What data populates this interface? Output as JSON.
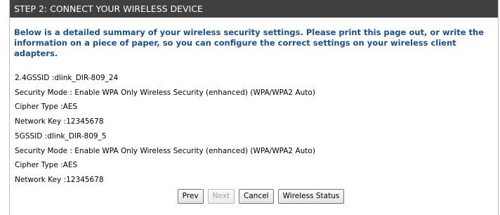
{
  "header": {
    "title": "STEP 2: CONNECT YOUR WIRELESS DEVICE"
  },
  "intro": "Below is a detailed summary of your wireless security settings. Please print this page out, or write the information on a piece of paper, so you can configure the correct settings on your wireless client adapters.",
  "band_24": {
    "ssid": "2.4GSSID :dlink_DIR-809_24",
    "security_mode": "Security Mode : Enable WPA Only Wireless Security (enhanced) (WPA/WPA2 Auto)",
    "cipher": "Cipher Type :AES",
    "network_key": "Network Key :12345678"
  },
  "band_5": {
    "ssid": "5GSSID :dlink_DIR-809_5",
    "security_mode": "Security Mode : Enable WPA Only Wireless Security (enhanced) (WPA/WPA2 Auto)",
    "cipher": "Cipher Type :AES",
    "network_key": "Network Key :12345678"
  },
  "buttons": {
    "prev": "Prev",
    "next": "Next",
    "cancel": "Cancel",
    "wireless_status": "Wireless Status"
  }
}
